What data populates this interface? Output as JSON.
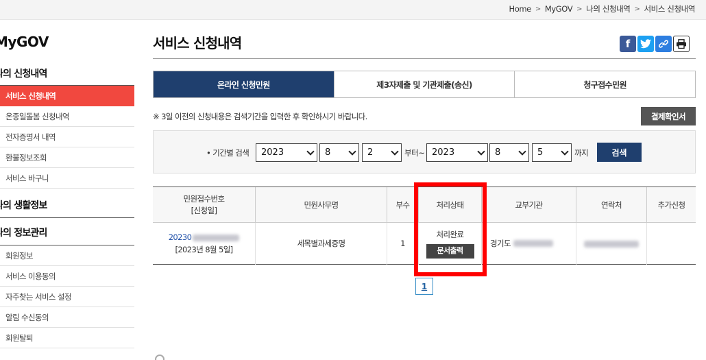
{
  "breadcrumb": [
    "Home",
    "MyGOV",
    "나의 신청내역",
    "서비스 신청내역"
  ],
  "sidebar": {
    "brand": "MyGOV",
    "section1": "나의 신청내역",
    "section1_items": [
      "서비스 신청내역",
      "온종일돌봄 신청내역",
      "전자증명서 내역",
      "환불정보조회",
      "서비스 바구니"
    ],
    "section2": "나의 생활정보",
    "section3": "나의 정보관리",
    "section3_items": [
      "회원정보",
      "서비스 이용동의",
      "자주찾는 서비스 설정",
      "알림 수신동의",
      "회원탈퇴"
    ]
  },
  "page": {
    "title": "서비스 신청내역"
  },
  "share_icons": [
    "facebook-icon",
    "twitter-icon",
    "link-icon",
    "print-icon"
  ],
  "tabs": [
    "온라인 신청민원",
    "제3자제출 및 기관제출(송신)",
    "청구접수민원"
  ],
  "notice": "※ 3일 이전의 신청내용은 검색기간을 입력한 후 확인하시기 바랍니다.",
  "confirm_button": "결제확인서",
  "search": {
    "label": "• 기간별 검색",
    "from_year": "2023",
    "from_month": "8",
    "from_day": "2",
    "from_text": "부터~",
    "to_year": "2023",
    "to_month": "8",
    "to_day": "5",
    "to_text": "까지",
    "button": "검색"
  },
  "table": {
    "headers": [
      "민원접수번호\n[신청일]",
      "민원사무명",
      "부수",
      "처리상태",
      "교부기관",
      "연락처",
      "추가신청"
    ],
    "row": {
      "receipt_no": "20230",
      "apply_date": "[2023년 8월 5일]",
      "service_name": "세목별과세증명",
      "copies": "1",
      "status": "처리완료",
      "print_button": "문서출력",
      "agency": "경기도"
    }
  },
  "pagination": {
    "current": "1"
  },
  "colors": {
    "active_tab": "#1f3f6e",
    "active_side": "#f1483f",
    "highlight": "#ff0000"
  }
}
